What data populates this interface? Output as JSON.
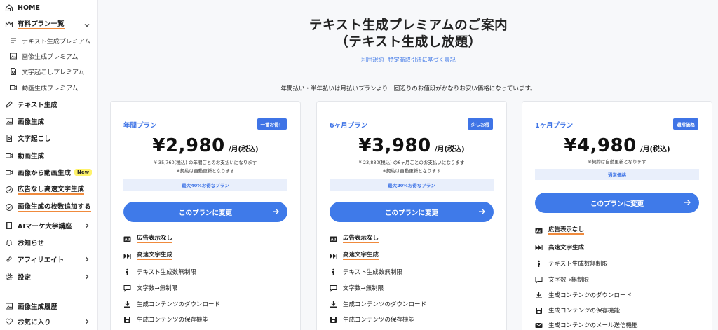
{
  "sidebar": {
    "items": [
      {
        "label": "HOME",
        "icon": "home-icon"
      },
      {
        "label": "有料プラン一覧",
        "icon": "crown-icon"
      },
      {
        "label": "テキスト生成プレミアム",
        "icon": "lines-icon"
      },
      {
        "label": "画像生成プレミアム",
        "icon": "image-icon"
      },
      {
        "label": "文字起こしプレミアム",
        "icon": "transcribe-icon"
      },
      {
        "label": "動画生成プレミアム",
        "icon": "video-icon"
      },
      {
        "label": "テキスト生成",
        "icon": "pen-icon"
      },
      {
        "label": "画像生成",
        "icon": "image-icon"
      },
      {
        "label": "文字起こし",
        "icon": "transcribe-icon"
      },
      {
        "label": "動画生成",
        "icon": "video-icon"
      },
      {
        "label": "画像から動画生成",
        "icon": "video-icon",
        "badge": "New"
      },
      {
        "label": "広告なし高速文字生成",
        "icon": "check-circle-icon"
      },
      {
        "label": "画像生成の枚数追加する",
        "icon": "check-circle-icon"
      },
      {
        "label": "AIマーケ大学講座",
        "icon": "book-icon"
      },
      {
        "label": "お知らせ",
        "icon": "bell-icon"
      },
      {
        "label": "アフィリエイト",
        "icon": "link-icon"
      },
      {
        "label": "設定",
        "icon": "gear-icon"
      },
      {
        "label": "画像生成履歴",
        "icon": "image-icon"
      },
      {
        "label": "お気に入り",
        "icon": "heart-icon"
      }
    ]
  },
  "header": {
    "title_line1": "テキスト生成プレミアムのご案内",
    "title_line2": "（テキスト生成し放題）",
    "link_terms": "利用規約",
    "link_law": "特定商取引法に基づく表記",
    "subtitle": "年間払い・半年払いは月払いプランより一回辺りのお値段がかなりお安い価格になっています。"
  },
  "plans": [
    {
      "name": "年間プラン",
      "badge": "一番お得！",
      "price": "¥2,980",
      "unit": "/月(税込)",
      "note1": "¥ 35,760(税込) の年間ごとのお支払いになります",
      "note2": "※契約は自動更新となります",
      "discount": "最大40%お得なプラン",
      "cta": "このプランに変更",
      "features": [
        "広告表示なし",
        "高速文字生成",
        "テキスト生成数無制限",
        "文字数→無制限",
        "生成コンテンツのダウンロード",
        "生成コンテンツの保存機能"
      ]
    },
    {
      "name": "6ヶ月プラン",
      "badge": "少しお得",
      "price": "¥3,980",
      "unit": "/月(税込)",
      "note1": "¥ 23,880(税込) の6ヶ月ごとのお支払いになります",
      "note2": "※契約は自動更新となります",
      "discount": "最大20%お得なプラン",
      "cta": "このプランに変更",
      "features": [
        "広告表示なし",
        "高速文字生成",
        "テキスト生成数無制限",
        "文字数→無制限",
        "生成コンテンツのダウンロード",
        "生成コンテンツの保存機能"
      ]
    },
    {
      "name": "1ヶ月プラン",
      "badge": "通常価格",
      "price": "¥4,980",
      "unit": "/月(税込)",
      "note1": "※契約は自動更新となります",
      "discount": "通常価格",
      "cta": "このプランに変更",
      "features": [
        "広告表示なし",
        "高速文字生成",
        "テキスト生成数無制限",
        "文字数→無制限",
        "生成コンテンツのダウンロード",
        "生成コンテンツの保存機能",
        "生成コンテンツのメール送信機能"
      ]
    }
  ],
  "colors": {
    "accent": "#3f7ae9",
    "underline": "#f08a3c",
    "badge_new": "#fff36b"
  }
}
